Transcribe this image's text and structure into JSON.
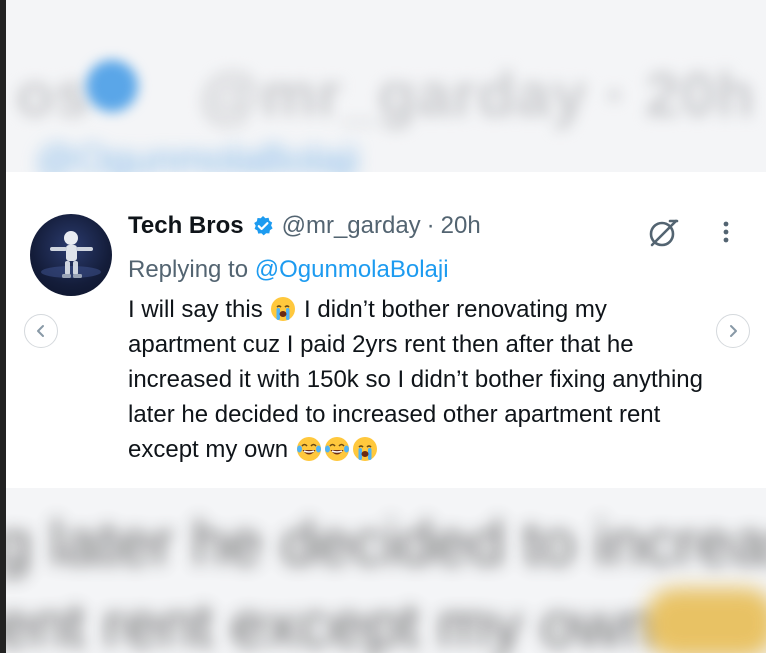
{
  "tweet": {
    "display_name": "Tech Bros",
    "handle": "@mr_garday",
    "separator": "·",
    "time": "20h",
    "replying_prefix": "Replying to ",
    "replying_to": "@OgunmolaBolaji",
    "text_part1": "I will say this ",
    "text_part2": " I didn’t bother renovating my apartment cuz I paid 2yrs rent then after that he increased it with 150k so I didn’t bother fixing anything later he decided to increased other apartment rent except my own ",
    "emojis_inline": [
      "crying-face"
    ],
    "emojis_trailing": [
      "laughing-tears-face",
      "laughing-tears-face",
      "crying-face"
    ]
  },
  "icons": {
    "verified": "verified-badge-icon",
    "grok": "grok-icon",
    "more": "more-vertical-icon",
    "prev": "chevron-left-icon",
    "next": "chevron-right-icon"
  },
  "colors": {
    "link": "#1d9bf0",
    "secondary_text": "#536471",
    "primary_text": "#0f1419",
    "verified": "#1d9bf0"
  }
}
